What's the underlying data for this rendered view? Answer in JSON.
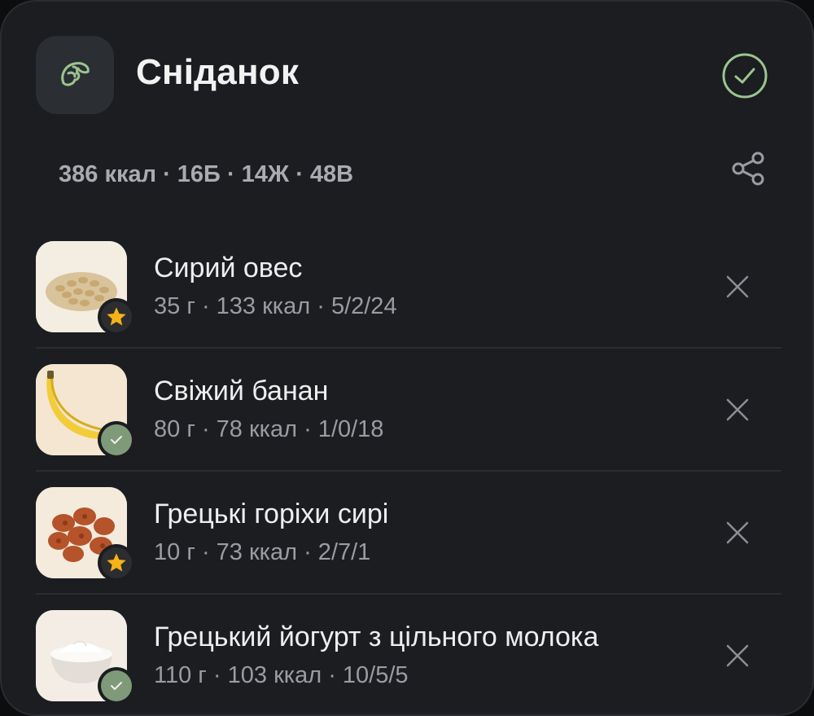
{
  "meal": {
    "title": "Сніданок",
    "icon": "croissant-icon",
    "summary": "386 ккал · 16Б · 14Ж · 48В"
  },
  "colors": {
    "accent": "#9cc48f",
    "badge_check": "#7f9a78",
    "star": "#f5b318",
    "background": "#1b1d21"
  },
  "items": [
    {
      "name": "Сирий овес",
      "meta": "35 г · 133 ккал · 5/2/24",
      "badge": "star",
      "thumb": "oats"
    },
    {
      "name": "Свіжий банан",
      "meta": "80 г · 78 ккал · 1/0/18",
      "badge": "check",
      "thumb": "banana"
    },
    {
      "name": "Грецькі горіхи сирі",
      "meta": "10 г · 73 ккал · 2/7/1",
      "badge": "star",
      "thumb": "walnuts"
    },
    {
      "name": "Грецький йогурт з цільного молока",
      "meta": "110 г · 103 ккал · 10/5/5",
      "badge": "check",
      "thumb": "yogurt"
    }
  ]
}
